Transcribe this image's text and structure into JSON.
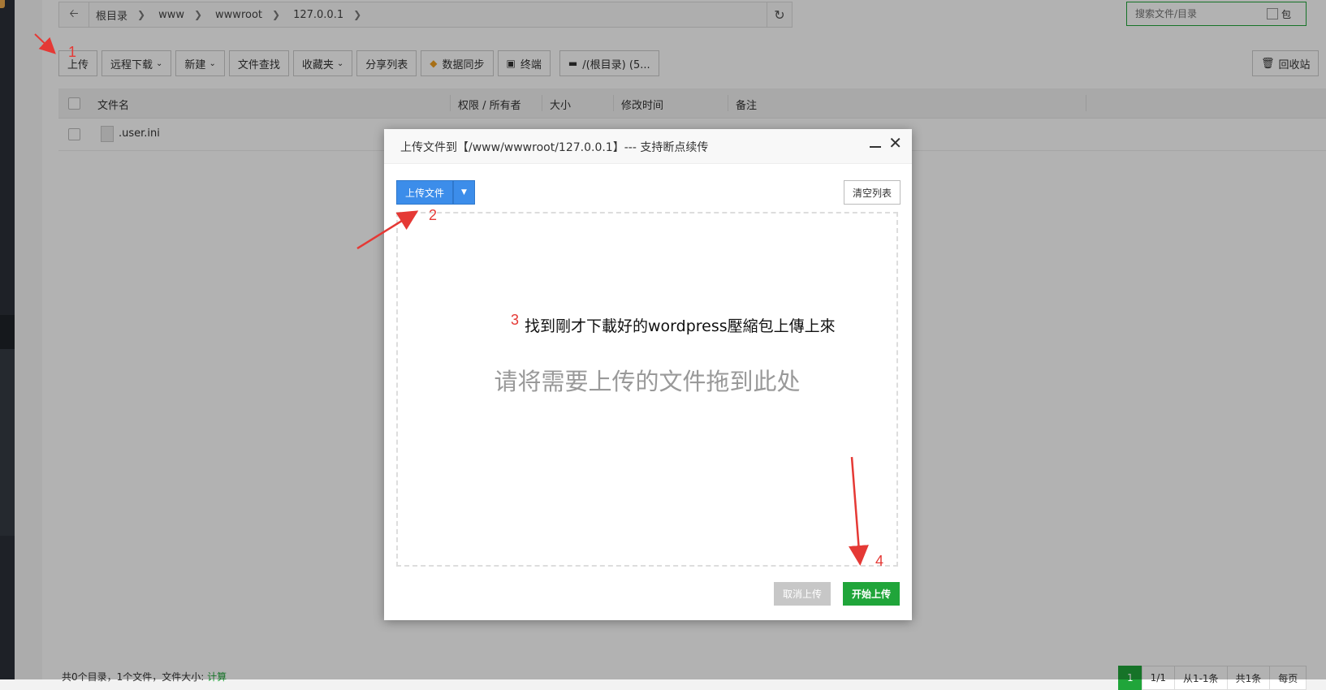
{
  "breadcrumb": {
    "items": [
      "根目录",
      "www",
      "wwwroot",
      "127.0.0.1"
    ]
  },
  "search": {
    "placeholder": "搜索文件/目录",
    "option_label": "包"
  },
  "toolbar": {
    "upload": "上传",
    "remote_download": "远程下载",
    "new": "新建",
    "file_search": "文件查找",
    "favorites": "收藏夹",
    "share_list": "分享列表",
    "data_sync": "数据同步",
    "terminal": "终端",
    "disk": "/(根目录) (5...",
    "recycle": "回收站"
  },
  "table": {
    "headers": [
      "文件名",
      "权限 / 所有者",
      "大小",
      "修改时间",
      "备注"
    ],
    "rows": [
      {
        "name": ".user.ini"
      }
    ]
  },
  "footer": {
    "summary": "共0个目录，1个文件，文件大小:",
    "calc": "计算",
    "pager": [
      "1",
      "1/1",
      "从1-1条",
      "共1条",
      "每页"
    ]
  },
  "modal": {
    "title": "上传文件到【/www/wwwroot/127.0.0.1】--- 支持断点续传",
    "upload_button": "上传文件",
    "clear_button": "清空列表",
    "drop_hint": "请将需要上传的文件拖到此处",
    "cancel_button": "取消上传",
    "start_button": "开始上传"
  },
  "annotations": {
    "step1": "1",
    "step2": "2",
    "step3": "3",
    "step3_text": "找到剛才下載好的wordpress壓縮包上傳上來",
    "step4": "4",
    "color": "#e53935"
  },
  "colors": {
    "primary_green": "#20a53a",
    "primary_blue": "#3c8dea"
  }
}
